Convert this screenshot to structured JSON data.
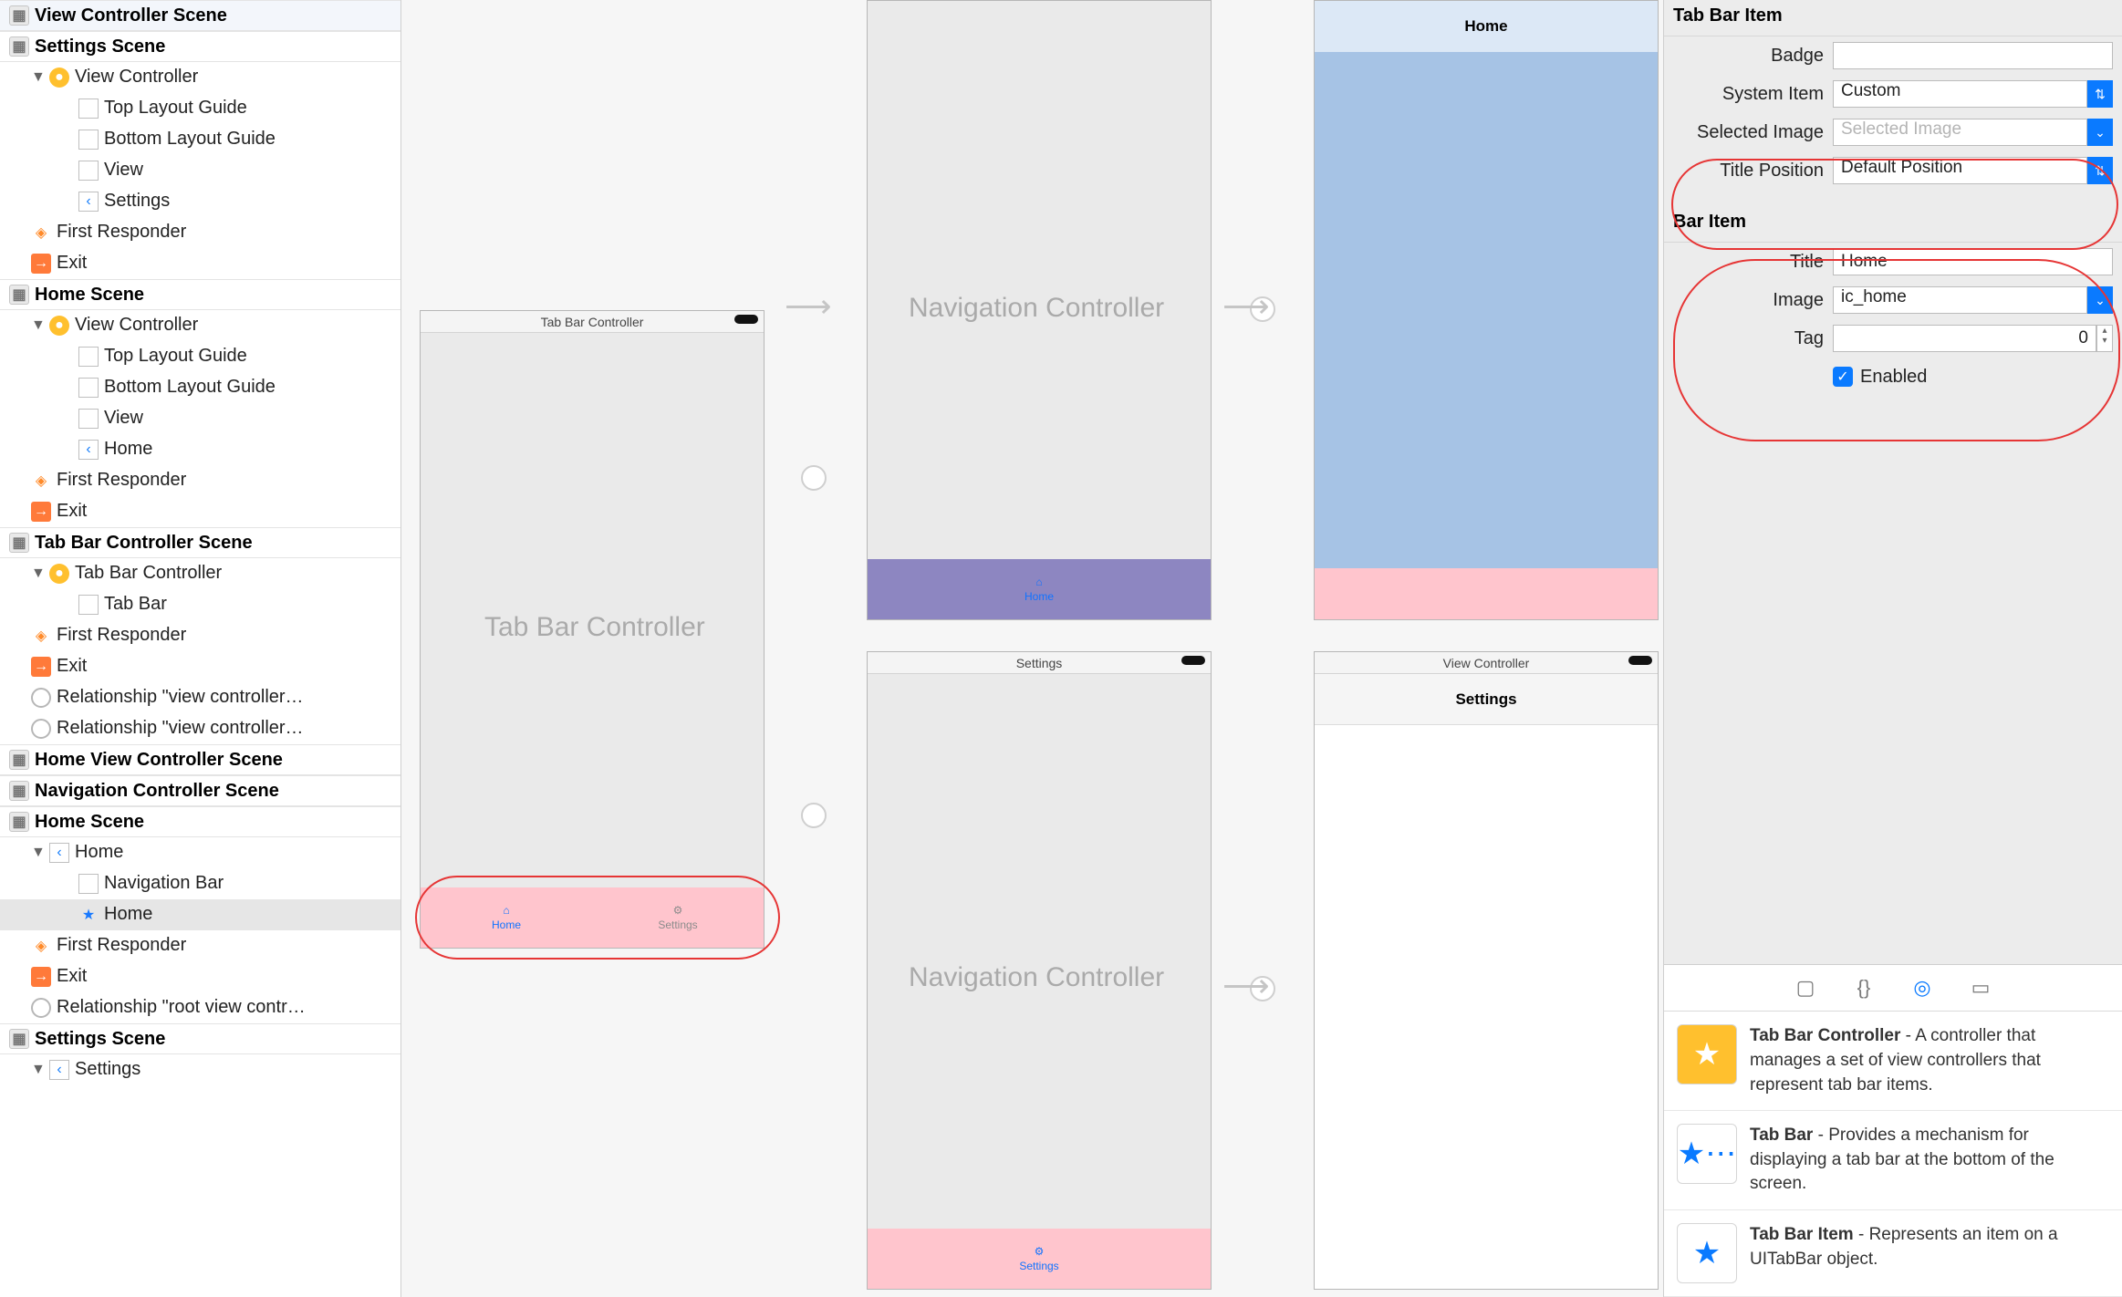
{
  "outline": {
    "scenes": [
      {
        "label": "View Controller Scene"
      },
      {
        "label": "Settings Scene",
        "children": [
          {
            "label": "View Controller",
            "icon": "vc-y",
            "children": [
              {
                "label": "Top Layout Guide",
                "icon": "sq"
              },
              {
                "label": "Bottom Layout Guide",
                "icon": "sq"
              },
              {
                "label": "View",
                "icon": "sq"
              },
              {
                "label": "Settings",
                "icon": "back"
              }
            ]
          },
          {
            "label": "First Responder",
            "icon": "cube"
          },
          {
            "label": "Exit",
            "icon": "exit"
          }
        ]
      },
      {
        "label": "Home Scene",
        "children": [
          {
            "label": "View Controller",
            "icon": "vc-y",
            "children": [
              {
                "label": "Top Layout Guide",
                "icon": "sq"
              },
              {
                "label": "Bottom Layout Guide",
                "icon": "sq"
              },
              {
                "label": "View",
                "icon": "sq"
              },
              {
                "label": "Home",
                "icon": "back"
              }
            ]
          },
          {
            "label": "First Responder",
            "icon": "cube"
          },
          {
            "label": "Exit",
            "icon": "exit"
          }
        ]
      },
      {
        "label": "Tab Bar Controller Scene",
        "children": [
          {
            "label": "Tab Bar Controller",
            "icon": "vc-y",
            "children": [
              {
                "label": "Tab Bar",
                "icon": "sq"
              }
            ]
          },
          {
            "label": "First Responder",
            "icon": "cube"
          },
          {
            "label": "Exit",
            "icon": "exit"
          },
          {
            "label": "Relationship \"view controller…",
            "icon": "circle"
          },
          {
            "label": "Relationship \"view controller…",
            "icon": "circle"
          }
        ]
      },
      {
        "label": "Home View Controller Scene"
      },
      {
        "label": "Navigation Controller Scene"
      },
      {
        "label": "Home Scene",
        "children2": [
          {
            "label": "Home",
            "icon": "back",
            "children": [
              {
                "label": "Navigation Bar",
                "icon": "sq"
              },
              {
                "label": "Home",
                "icon": "star",
                "sel": true
              }
            ]
          },
          {
            "label": "First Responder",
            "icon": "cube"
          },
          {
            "label": "Exit",
            "icon": "exit"
          },
          {
            "label": "Relationship \"root view contr…",
            "icon": "circle"
          }
        ]
      },
      {
        "label": "Settings Scene",
        "last": true
      }
    ],
    "settings_last": "Settings"
  },
  "canvas": {
    "tabbar_title": "Tab Bar Controller",
    "nav_title": "Navigation Controller",
    "settings_mini": "Settings",
    "home_mini": "Home",
    "viewcontroller_mini": "View Controller",
    "tab_home": "Home",
    "tab_settings": "Settings"
  },
  "inspector": {
    "section1": "Tab Bar Item",
    "badge_label": "Badge",
    "badge_value": "",
    "system_item_label": "System Item",
    "system_item_value": "Custom",
    "selected_image_label": "Selected Image",
    "selected_image_placeholder": "Selected Image",
    "title_position_label": "Title Position",
    "title_position_value": "Default Position",
    "section2": "Bar Item",
    "title_label": "Title",
    "title_value": "Home",
    "image_label": "Image",
    "image_value": "ic_home",
    "tag_label": "Tag",
    "tag_value": "0",
    "enabled_label": "Enabled"
  },
  "library": [
    {
      "title": "Tab Bar Controller",
      "desc": " - A controller that manages a set of view controllers that represent tab bar items.",
      "thumb": "tbc"
    },
    {
      "title": "Tab Bar",
      "desc": " - Provides a mechanism for displaying a tab bar at the bottom of the screen.",
      "thumb": "tb"
    },
    {
      "title": "Tab Bar Item",
      "desc": " - Represents an item on a UITabBar object.",
      "thumb": "tbi"
    }
  ]
}
